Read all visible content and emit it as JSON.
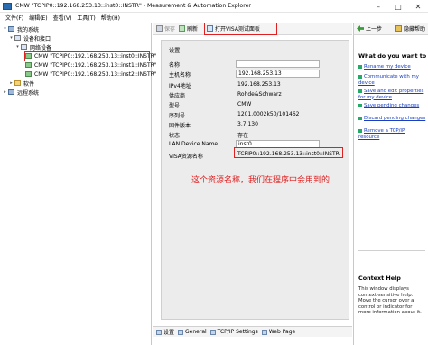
{
  "window": {
    "title": "CMW \"TCPIP0::192.168.253.13::inst0::INSTR\" - Measurement & Automation Explorer",
    "controls": [
      "–",
      "□",
      "✕"
    ]
  },
  "menu": [
    "文件(F)",
    "编辑(E)",
    "查看(V)",
    "工具(T)",
    "帮助(H)"
  ],
  "tree": {
    "items": [
      {
        "label": "我的系统",
        "twisty": "▾"
      },
      {
        "label": "设备和接口",
        "twisty": "▾"
      },
      {
        "label": "网络设备",
        "twisty": "▾"
      },
      {
        "label": "CMW \"TCPIP0::192.168.253.13::inst0::INSTR\"",
        "twisty": ""
      },
      {
        "label": "CMW \"TCPIP0::192.168.253.13::inst1::INSTR\"",
        "twisty": ""
      },
      {
        "label": "CMW \"TCPIP0::192.168.253.13::inst2::INSTR\"",
        "twisty": ""
      },
      {
        "label": "软件",
        "twisty": "▸"
      },
      {
        "label": "远程系统",
        "twisty": "▸"
      }
    ]
  },
  "toolbar": {
    "save_label": "保存",
    "refresh_label": "刷新",
    "open_visa_label": "打开VISA测试面板"
  },
  "properties": {
    "section_title": "设置",
    "rows": [
      {
        "label": "名称",
        "value": ""
      },
      {
        "label": "主机名称",
        "value": "192.168.253.13"
      },
      {
        "label": "IPv4地址",
        "value": "192.168.253.13"
      },
      {
        "label": "供应商",
        "value": "Rohde&Schwarz"
      },
      {
        "label": "型号",
        "value": "CMW"
      },
      {
        "label": "序列号",
        "value": "1201.0002k50/101462"
      },
      {
        "label": "固件版本",
        "value": "3.7.130"
      },
      {
        "label": "状态",
        "value": "存在"
      },
      {
        "label": "LAN Device Name",
        "value": "inst0"
      },
      {
        "label": "VISA资源名称",
        "value": "TCPIP0::192.168.253.13::inst0::INSTR"
      }
    ]
  },
  "annotation": "这个资源名称，我们在程序中会用到的",
  "tabs": [
    "设置",
    "General",
    "TCP/IP Settings",
    "Web Page"
  ],
  "help": {
    "back_label": "上一步",
    "hide_label": "隐藏帮助",
    "heading": "What do you want to do?",
    "links": [
      "Rename my device",
      "Communicate with my device",
      "Save and edit properties for my device",
      "Save pending changes",
      "Discard pending changes",
      "Remove a TCP/IP resource"
    ],
    "context_heading": "Context Help",
    "context_text": "This window displays context-sensitive help. Move the cursor over a control or indicator for more information about it."
  },
  "colors": {
    "highlight_red": "#e02020",
    "link_blue": "#1a3fbf"
  }
}
